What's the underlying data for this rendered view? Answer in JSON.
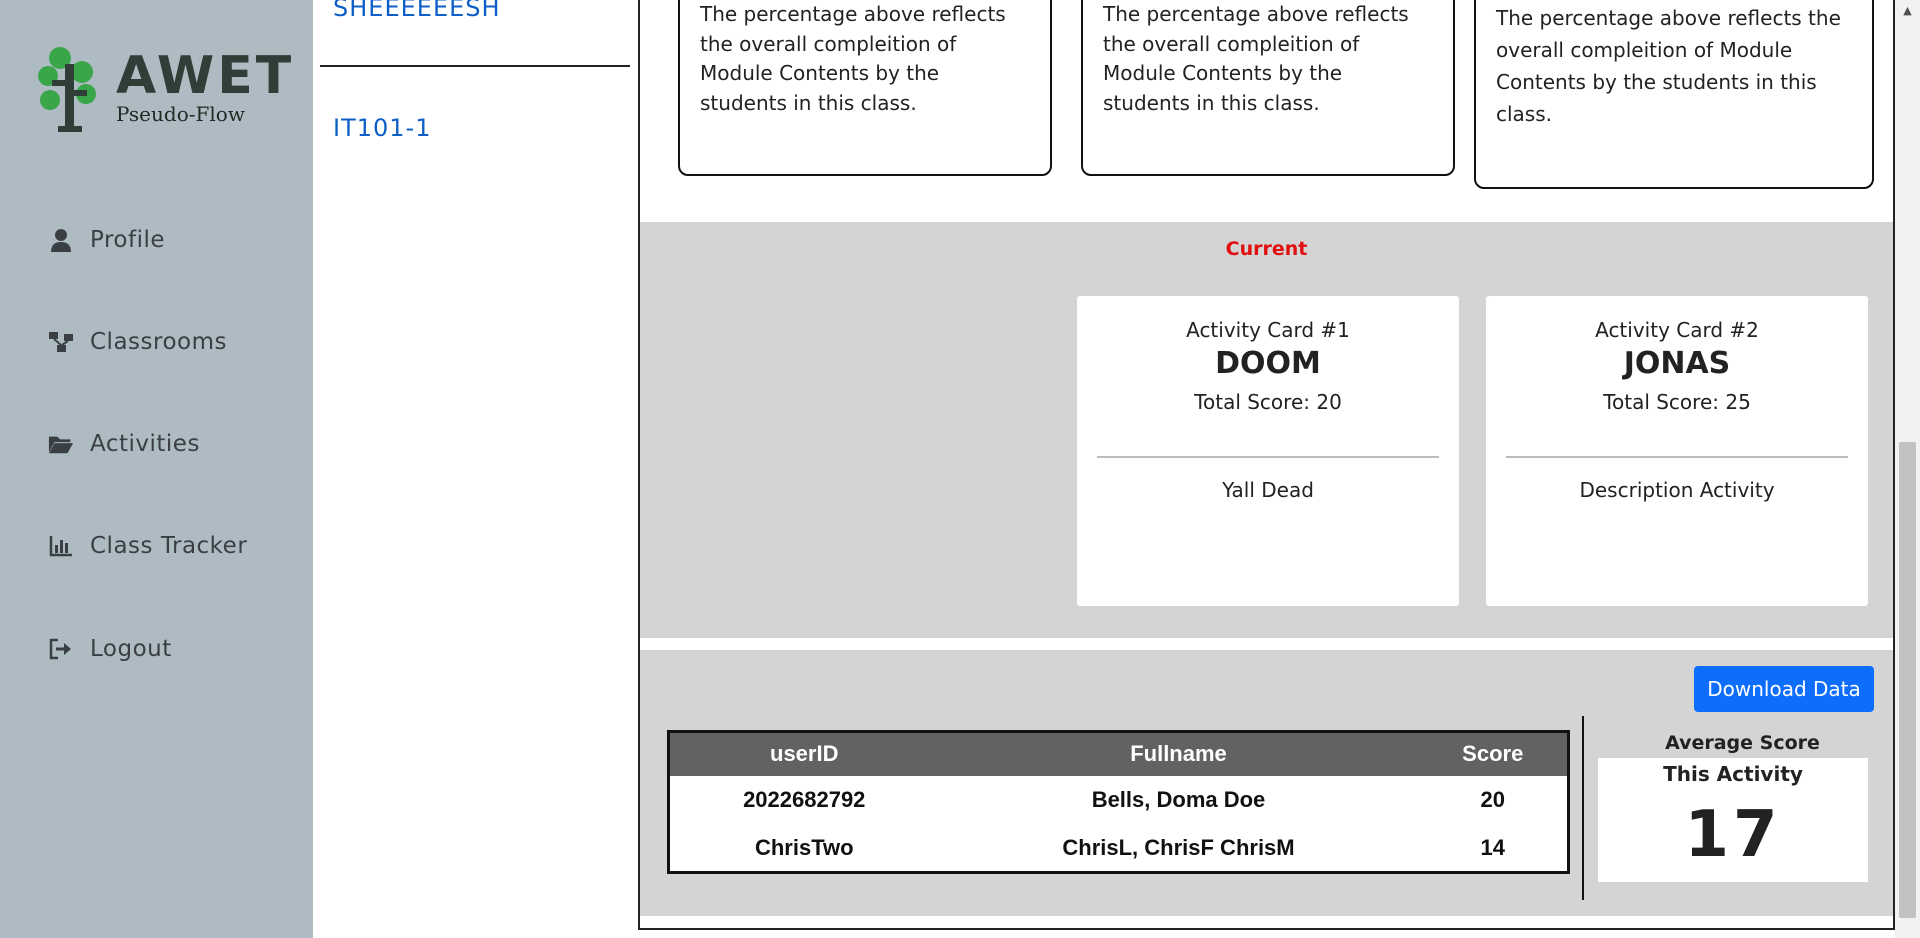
{
  "brand": {
    "title": "AWET",
    "subtitle": "Pseudo-Flow"
  },
  "sidebar": {
    "items": [
      {
        "label": "Profile",
        "icon": "user-icon"
      },
      {
        "label": "Classrooms",
        "icon": "network-icon"
      },
      {
        "label": "Activities",
        "icon": "folder-open-icon"
      },
      {
        "label": "Class Tracker",
        "icon": "bar-chart-icon"
      },
      {
        "label": "Logout",
        "icon": "logout-icon"
      }
    ]
  },
  "classrooms": {
    "items": [
      "SHEEEEEESH",
      "IT101-1"
    ]
  },
  "info_cards": [
    {
      "text": "The percentage above reflects the overall compleition of Module Contents by the students in this class."
    },
    {
      "text": "The percentage above reflects the overall compleition of Module Contents by the students in this class."
    },
    {
      "text": "The percentage above reflects the overall compleition of Module Contents by the students in this class."
    }
  ],
  "current": {
    "label": "Current",
    "cards": [
      {
        "number": "Activity Card #1",
        "name": "DOOM",
        "score": "Total Score: 20",
        "description": "Yall Dead"
      },
      {
        "number": "Activity Card #2",
        "name": "JONAS",
        "score": "Total Score: 25",
        "description": "Description Activity"
      }
    ]
  },
  "results": {
    "download_label": "Download Data",
    "columns": [
      "userID",
      "Fullname",
      "Score"
    ],
    "rows": [
      [
        "2022682792",
        "Bells, Doma Doe",
        "20"
      ],
      [
        "ChrisTwo",
        "ChrisL, ChrisF ChrisM",
        "14"
      ]
    ],
    "average": {
      "title": "Average Score",
      "subtitle": "This Activity",
      "value": "17"
    }
  },
  "colors": {
    "sidebar_bg": "#aebbc3",
    "link": "#0d5fc8",
    "accent_red": "#e01010",
    "primary_button": "#0d6efd",
    "band_gray": "#d4d4d4",
    "table_header": "#626262"
  }
}
